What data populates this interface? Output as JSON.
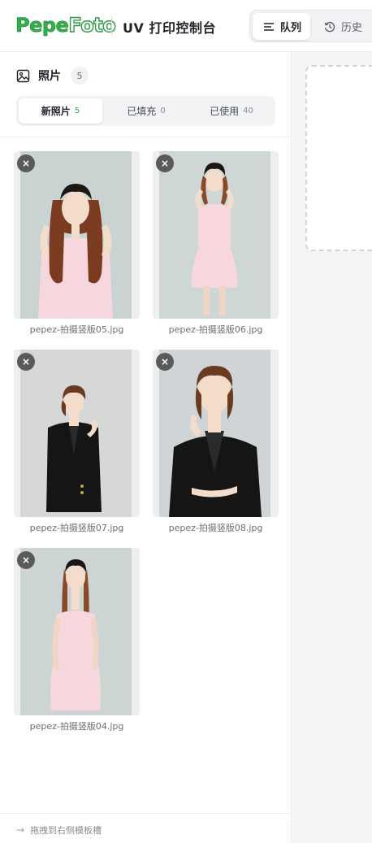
{
  "header": {
    "logo_part1": "Pepe",
    "logo_part2": "Foto",
    "title": "UV 打印控制台",
    "nav": {
      "queue_label": "队列",
      "history_label": "历史"
    }
  },
  "panel": {
    "title": "照片",
    "count": "5",
    "tabs": [
      {
        "label": "新照片",
        "count": "5"
      },
      {
        "label": "已填充",
        "count": "0"
      },
      {
        "label": "已使用",
        "count": "40"
      }
    ],
    "photos": [
      {
        "filename": "pepez-拍摄竖版05.jpg"
      },
      {
        "filename": "pepez-拍摄竖版06.jpg"
      },
      {
        "filename": "pepez-拍摄竖版07.jpg"
      },
      {
        "filename": "pepez-拍摄竖版08.jpg"
      },
      {
        "filename": "pepez-拍摄竖版04.jpg"
      }
    ],
    "close_glyph": "×",
    "footer_hint": "拖拽到右侧模板槽"
  },
  "colors": {
    "brand_green": "#2fb24a",
    "dark_outfit": "#151515",
    "pink_outfit": "#f7d7de",
    "photo_bg": "#c9d3d1"
  }
}
